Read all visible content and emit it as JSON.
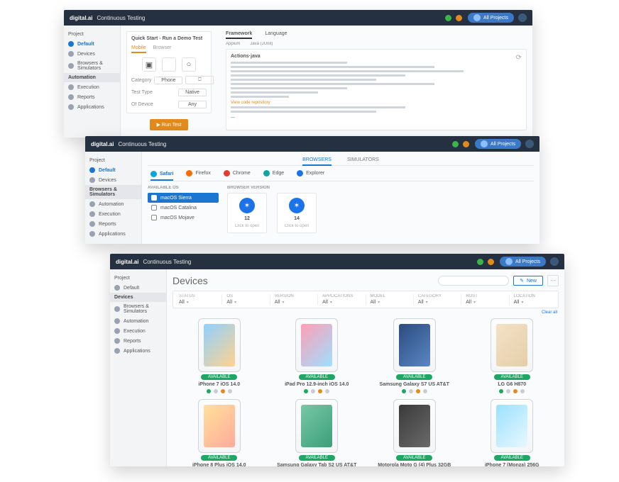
{
  "brand": "digital.ai",
  "product": "Continuous Testing",
  "user": "All Projects",
  "windows": {
    "w1": {
      "sidebar_project_label": "Project",
      "sidebar": [
        {
          "label": "Default",
          "active": true
        },
        {
          "label": "Devices"
        },
        {
          "label": "Browsers & Simulators"
        }
      ],
      "sidebar_header": "Automation",
      "sidebar2": [
        {
          "label": "Execution"
        },
        {
          "label": "Reports"
        },
        {
          "label": "Applications"
        }
      ],
      "panel": {
        "title": "Quick Start - Run a Demo Test",
        "tabs": [
          "Mobile",
          "Browser"
        ],
        "active_tab": "Mobile",
        "os_options": [
          "android",
          "apple",
          "any"
        ],
        "field_category_label": "Category",
        "field_category_value": "Phone",
        "field_testtype_label": "Test Type",
        "field_testtype_value": "Native",
        "field_device_label": "Of Device",
        "field_device_value": "Any",
        "run_button": "▶ Run Test"
      },
      "report": {
        "tabs": [
          "Framework",
          "Language"
        ],
        "meta1": "Appium",
        "meta2": "Java (JUnit)",
        "box_title": "Actions·java",
        "link1": "View code repository",
        "link2": "—"
      }
    },
    "w2": {
      "sidebar_project_label": "Project",
      "sidebar": [
        {
          "label": "Default",
          "active": true
        },
        {
          "label": "Devices"
        }
      ],
      "sidebar_header": "Browsers & Simulators",
      "sidebar2": [
        {
          "label": "Automation"
        },
        {
          "label": "Execution"
        },
        {
          "label": "Reports"
        },
        {
          "label": "Applications"
        }
      ],
      "top_tabs": [
        "BROWSERS",
        "SIMULATORS"
      ],
      "active_top_tab": "BROWSERS",
      "browsers": [
        "Safari",
        "Firefox",
        "Chrome",
        "Edge",
        "Explorer"
      ],
      "active_browser": "Safari",
      "available_os_header": "Available OS",
      "available_os": [
        {
          "label": "macOS Sierra",
          "selected": true
        },
        {
          "label": "macOS Catalina"
        },
        {
          "label": "macOS Mojave"
        }
      ],
      "browser_version_header": "Browser Version",
      "versions": [
        {
          "label": "12",
          "sub": "Click to open"
        },
        {
          "label": "14",
          "sub": "Click to open"
        }
      ]
    },
    "w3": {
      "sidebar_project_label": "Project",
      "sidebar": [
        {
          "label": "Default"
        },
        {
          "label": "Devices",
          "active": true
        }
      ],
      "sidebar_header": "Browsers & Simulators",
      "sidebar2": [
        {
          "label": "Automation"
        },
        {
          "label": "Execution"
        },
        {
          "label": "Reports"
        },
        {
          "label": "Applications"
        }
      ],
      "title": "Devices",
      "new_button": "New",
      "filters": [
        {
          "label": "Status",
          "value": "All"
        },
        {
          "label": "OS",
          "value": "All"
        },
        {
          "label": "Version",
          "value": "All"
        },
        {
          "label": "Applications",
          "value": "All"
        },
        {
          "label": "Model",
          "value": "All"
        },
        {
          "label": "Category",
          "value": "All"
        },
        {
          "label": "Host",
          "value": "All"
        },
        {
          "label": "Location",
          "value": "All"
        }
      ],
      "clear_all": "Clear all",
      "status_pill": "AVAILABLE",
      "devices_row1": [
        {
          "name": "iPhone 7 iOS 14.0",
          "scr": "scr-a"
        },
        {
          "name": "iPad Pro 12.9-inch iOS 14.0",
          "scr": "scr-b"
        },
        {
          "name": "Samsung Galaxy S7 US AT&T",
          "scr": "scr-c"
        },
        {
          "name": "LG G6 H870",
          "scr": "scr-d"
        }
      ],
      "devices_row2": [
        {
          "name": "iPhone 8 Plus iOS 14.0",
          "scr": "scr-e"
        },
        {
          "name": "Samsung Galaxy Tab S2 US AT&T",
          "scr": "scr-f"
        },
        {
          "name": "Motorola Moto G (4) Plus 32GB",
          "scr": "scr-g"
        },
        {
          "name": "iPhone 7 (Monza) 256G",
          "scr": "scr-h"
        }
      ]
    }
  }
}
